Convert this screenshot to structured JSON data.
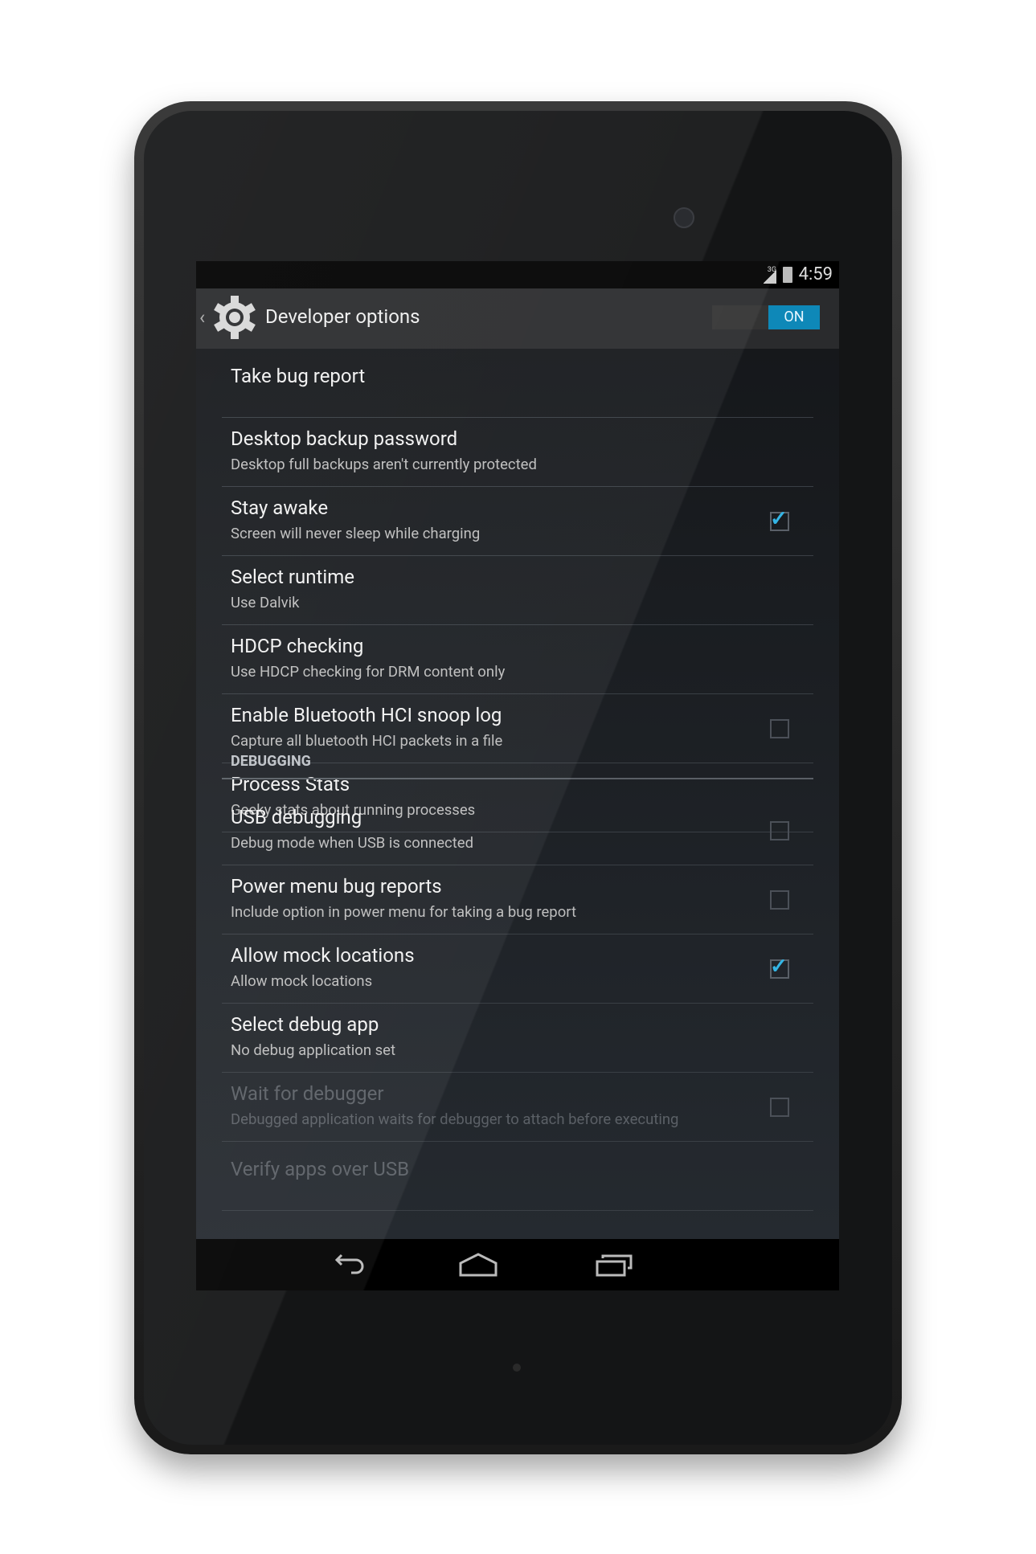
{
  "status_bar": {
    "network": "3G",
    "time": "4:59"
  },
  "action_bar": {
    "title": "Developer options",
    "toggle": "ON"
  },
  "items": [
    {
      "title": "Take bug report"
    },
    {
      "title": "Desktop backup password",
      "summary": "Desktop full backups aren't currently protected"
    },
    {
      "title": "Stay awake",
      "summary": "Screen will never sleep while charging",
      "checked": true
    },
    {
      "title": "Select runtime",
      "summary": "Use Dalvik"
    },
    {
      "title": "HDCP checking",
      "summary": "Use HDCP checking for DRM content only"
    },
    {
      "title": "Enable Bluetooth HCI snoop log",
      "summary": "Capture all bluetooth HCI packets in a file",
      "checked": false
    },
    {
      "title": "Process Stats",
      "summary": "Geeky stats about running processes"
    }
  ],
  "debugging": {
    "header": "DEBUGGING",
    "items": [
      {
        "title": "USB debugging",
        "summary": "Debug mode when USB is connected",
        "checked": false
      },
      {
        "title": "Power menu bug reports",
        "summary": "Include option in power menu for taking a bug report",
        "checked": false
      },
      {
        "title": "Allow mock locations",
        "summary": "Allow mock locations",
        "checked": true
      },
      {
        "title": "Select debug app",
        "summary": "No debug application set"
      },
      {
        "title": "Wait for debugger",
        "summary": "Debugged application waits for debugger to attach before executing",
        "checked": false,
        "disabled": true
      },
      {
        "title": "Verify apps over USB",
        "disabled": true
      }
    ]
  },
  "colors": {
    "accent": "#34b5e5",
    "toggle_on": "#0e88b8"
  }
}
